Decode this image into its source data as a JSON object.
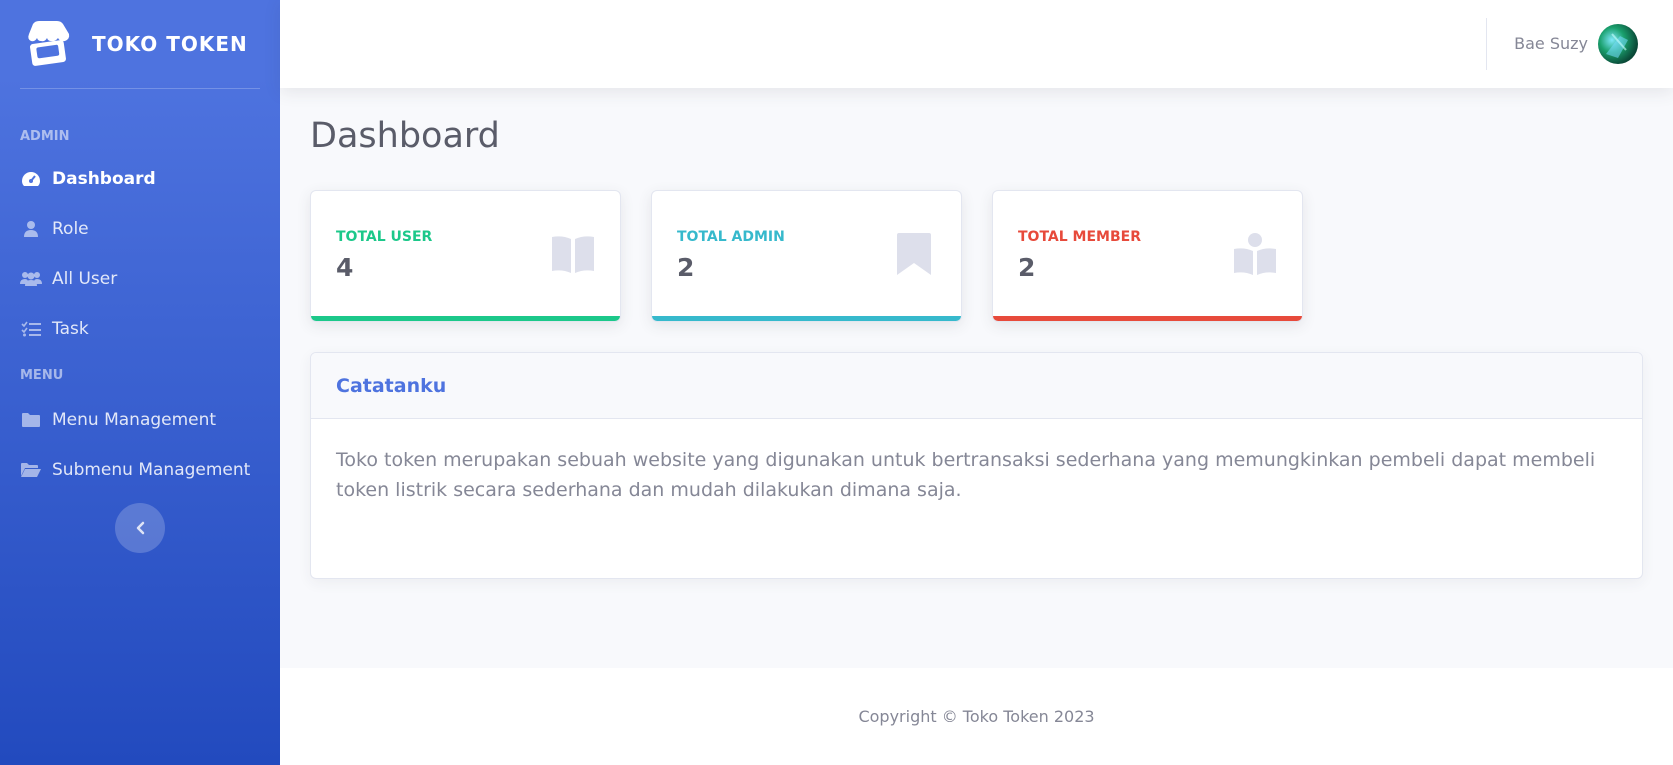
{
  "brand": {
    "name": "TOKO TOKEN",
    "icon": "store-icon"
  },
  "sidebar": {
    "headings": {
      "admin": "ADMIN",
      "menu": "MENU"
    },
    "admin_items": [
      {
        "label": "Dashboard",
        "icon": "tachometer-icon",
        "active": true
      },
      {
        "label": "Role",
        "icon": "user-icon"
      },
      {
        "label": "All User",
        "icon": "users-icon"
      },
      {
        "label": "Task",
        "icon": "tasks-icon"
      }
    ],
    "menu_items": [
      {
        "label": "Menu Management",
        "icon": "folder-icon"
      },
      {
        "label": "Submenu Management",
        "icon": "folder-open-icon"
      }
    ],
    "toggle_icon": "chevron-left-icon"
  },
  "topbar": {
    "user_name": "Bae Suzy"
  },
  "page": {
    "title": "Dashboard"
  },
  "cards": [
    {
      "label": "TOTAL USER",
      "value": "4",
      "color": "#1cc88a",
      "icon": "book-open-icon"
    },
    {
      "label": "TOTAL ADMIN",
      "value": "2",
      "color": "#36b9cc",
      "icon": "bookmark-icon"
    },
    {
      "label": "TOTAL MEMBER",
      "value": "2",
      "color": "#e74a3b",
      "icon": "book-reader-icon"
    }
  ],
  "note": {
    "title": "Catatanku",
    "body": "Toko token merupakan sebuah website yang digunakan untuk bertransaksi sederhana yang memungkinkan pembeli dapat membeli token listrik secara sederhana dan mudah dilakukan dimana saja."
  },
  "footer": {
    "copyright": "Copyright © Toko Token 2023"
  },
  "colors": {
    "primary": "#4e73df",
    "primary_dark": "#224abe",
    "text": "#858796",
    "heading": "#5a5c69"
  }
}
